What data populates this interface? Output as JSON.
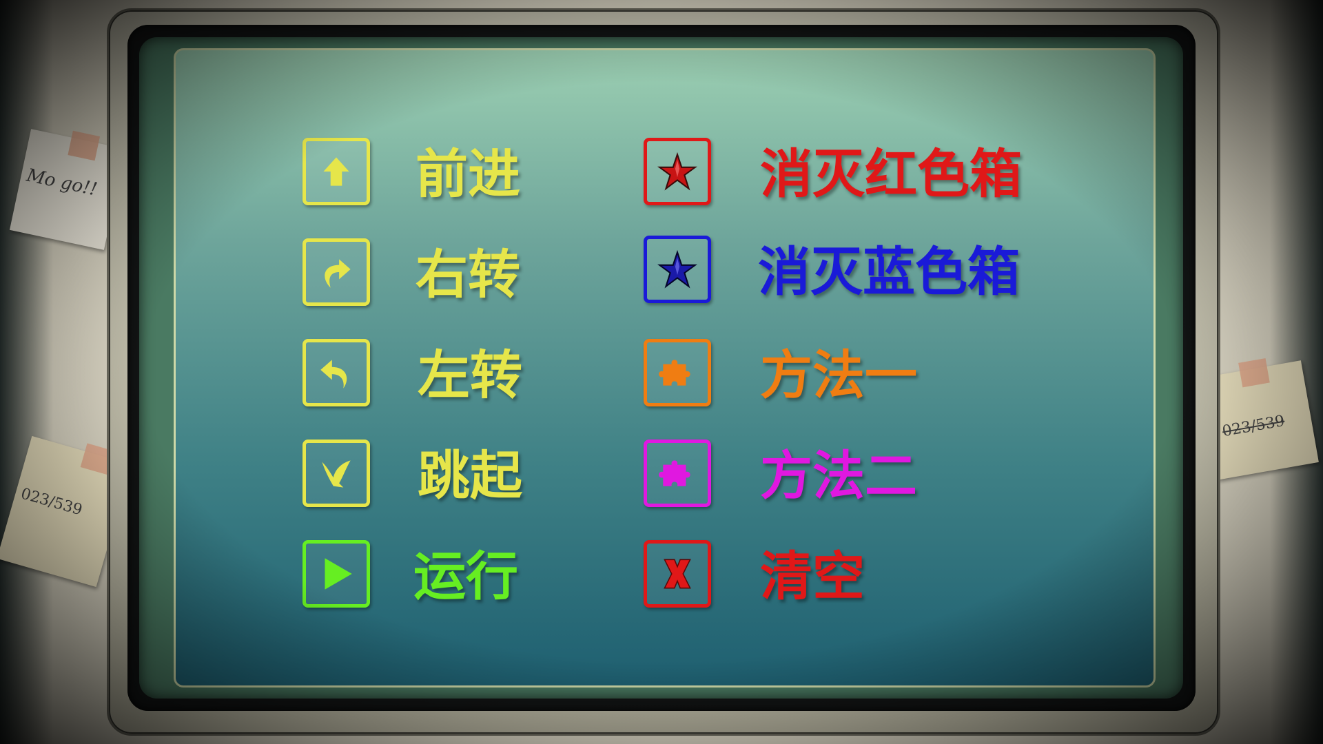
{
  "notes": {
    "top_left": "Mo go!!",
    "bottom_left": "023/539",
    "right": "023/539"
  },
  "commands": {
    "forward": {
      "label": "前进",
      "icon": "up-arrow-icon",
      "color": "#e6e64a"
    },
    "turn_right": {
      "label": "右转",
      "icon": "turn-right-icon",
      "color": "#e6e64a"
    },
    "turn_left": {
      "label": "左转",
      "icon": "turn-left-icon",
      "color": "#e6e64a"
    },
    "jump": {
      "label": "跳起",
      "icon": "bird-icon",
      "color": "#e6e64a"
    },
    "run": {
      "label": "运行",
      "icon": "play-icon",
      "color": "#66ee22"
    },
    "destroy_red": {
      "label": "消灭红色箱",
      "icon": "red-star-icon",
      "color": "#e01818"
    },
    "destroy_blue": {
      "label": "消灭蓝色箱",
      "icon": "blue-star-icon",
      "color": "#1a1ad8"
    },
    "method_one": {
      "label": "方法一",
      "icon": "orange-puzzle-icon",
      "color": "#f07d12"
    },
    "method_two": {
      "label": "方法二",
      "icon": "magenta-puzzle-icon",
      "color": "#e018e0"
    },
    "clear": {
      "label": "清空",
      "icon": "x-icon",
      "color": "#e01818"
    }
  }
}
